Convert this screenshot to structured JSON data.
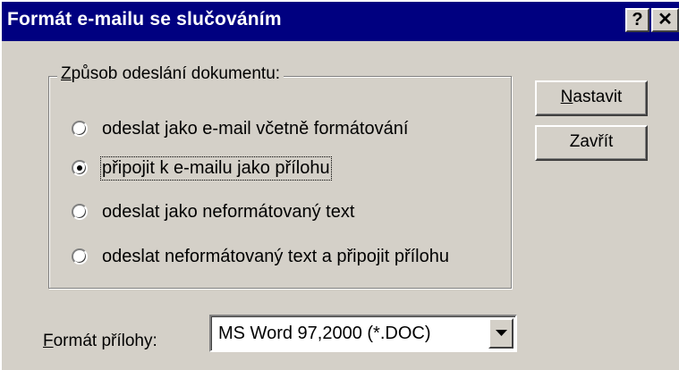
{
  "window": {
    "title": "Formát e-mailu se slučováním",
    "help_label": "?",
    "close_label": "✕"
  },
  "group": {
    "legend_first": "Z",
    "legend_rest": "působ odeslání dokumentu:"
  },
  "radios": [
    {
      "label": "odeslat jako e-mail včetně formátování",
      "checked": false
    },
    {
      "label": "připojit k e-mailu jako přílohu",
      "checked": true
    },
    {
      "label": "odeslat jako neformátovaný text",
      "checked": false
    },
    {
      "label": "odeslat neformátovaný text a připojit přílohu",
      "checked": false
    }
  ],
  "buttons": {
    "nastavit_first": "N",
    "nastavit_rest": "astavit",
    "zavrit": "Zavřít"
  },
  "attachment_format": {
    "label_first": "F",
    "label_rest": "ormát přílohy:",
    "value": "MS Word 97,2000 (*.DOC)"
  }
}
